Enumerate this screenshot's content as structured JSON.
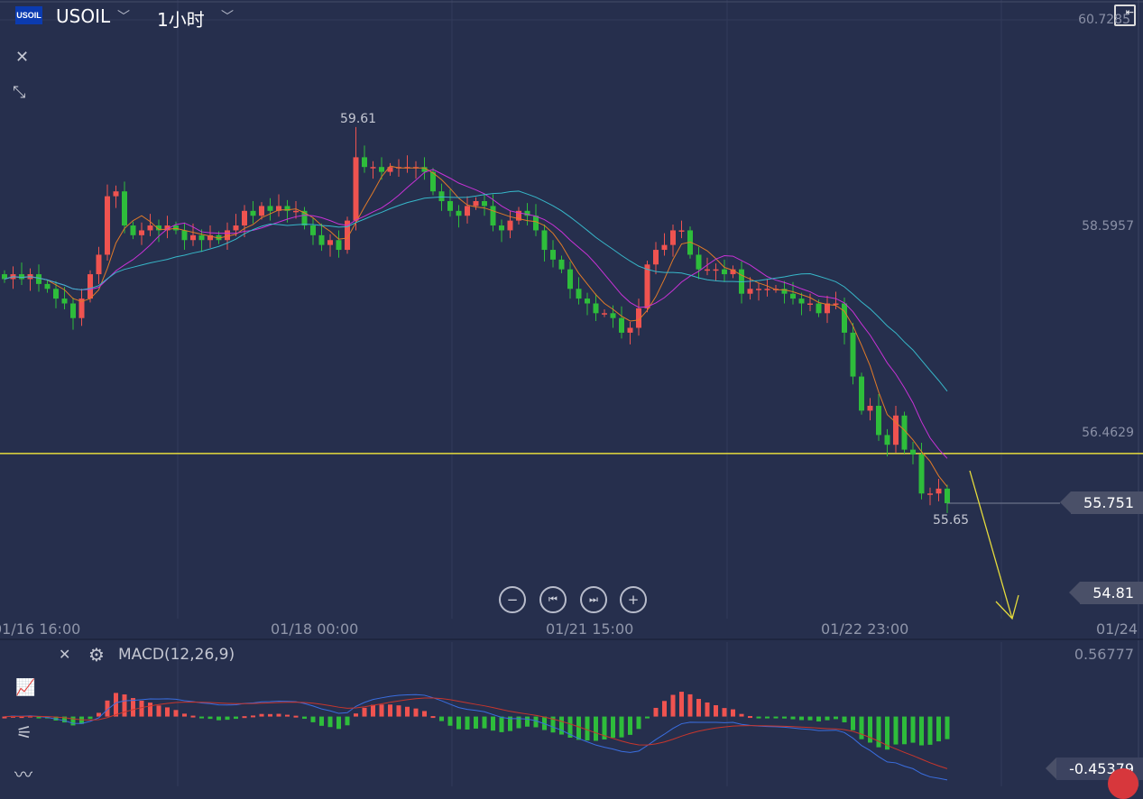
{
  "header": {
    "symbol_badge": "USOIL",
    "symbol": "USOIL",
    "timeframe": "1小时"
  },
  "icons": {
    "close": "close-icon",
    "collapse": "collapse-arrows-icon",
    "price_scale": "ruler-arrow-icon",
    "settings": "gear-icon",
    "indicator": "chart-indicator-icon",
    "drawing": "compass-icon",
    "pulse": "pulse-icon"
  },
  "colors": {
    "up": "#ef5350",
    "down": "#2ebd3b",
    "ma5": "#e07a28",
    "ma10": "#c832d6",
    "ma20": "#37b7c9",
    "alert_line": "#e6dc3c",
    "macd_dif": "#3a6ee0",
    "macd_dea": "#c8362c",
    "background": "#262f4d"
  },
  "zoom_controls": {
    "zoom_out": "−",
    "prev": "⏮",
    "next": "⏭",
    "zoom_in": "+"
  },
  "chart_data": {
    "type": "candlestick",
    "price_axis_ticks": [
      "60.7285",
      "58.5957",
      "56.4629"
    ],
    "time_axis_ticks": [
      "01/16 16:00",
      "01/18 00:00",
      "01/21 15:00",
      "01/22 23:00",
      "01/24"
    ],
    "ylim": [
      54.6,
      60.73
    ],
    "annotations": {
      "high": "59.61",
      "low": "55.65"
    },
    "current_price": "55.751",
    "target_price": "54.81",
    "alert_line_price": 56.26,
    "closes": [
      58.05,
      58.1,
      58.05,
      58.1,
      58.0,
      57.95,
      57.85,
      57.8,
      57.65,
      57.85,
      58.1,
      58.3,
      58.9,
      58.95,
      58.6,
      58.5,
      58.55,
      58.6,
      58.55,
      58.6,
      58.55,
      58.45,
      58.5,
      58.45,
      58.5,
      58.45,
      58.55,
      58.6,
      58.75,
      58.7,
      58.8,
      58.75,
      58.8,
      58.75,
      58.75,
      58.6,
      58.5,
      58.4,
      58.45,
      58.35,
      58.65,
      59.3,
      59.2,
      59.2,
      59.15,
      59.2,
      59.2,
      59.2,
      59.2,
      59.15,
      58.95,
      58.85,
      58.75,
      58.7,
      58.8,
      58.85,
      58.8,
      58.6,
      58.55,
      58.65,
      58.75,
      58.7,
      58.55,
      58.35,
      58.25,
      58.15,
      57.95,
      57.85,
      57.8,
      57.7,
      57.7,
      57.65,
      57.5,
      57.55,
      57.75,
      58.2,
      58.35,
      58.4,
      58.55,
      58.55,
      58.3,
      58.15,
      58.15,
      58.15,
      58.1,
      58.15,
      57.9,
      57.95,
      57.95,
      57.95,
      57.95,
      57.9,
      57.85,
      57.8,
      57.8,
      57.7,
      57.8,
      57.8,
      57.5,
      57.05,
      56.7,
      56.75,
      56.45,
      56.35,
      56.65,
      56.3,
      56.25,
      55.85,
      55.85,
      55.9,
      55.75
    ],
    "indicators": [
      "MA5",
      "MA10",
      "MA20"
    ]
  },
  "macd": {
    "title": "MACD(12,26,9)",
    "scale_top": "0.56777",
    "scale_bottom": "-0.45379",
    "range": [
      -0.45379,
      0.56777
    ]
  }
}
